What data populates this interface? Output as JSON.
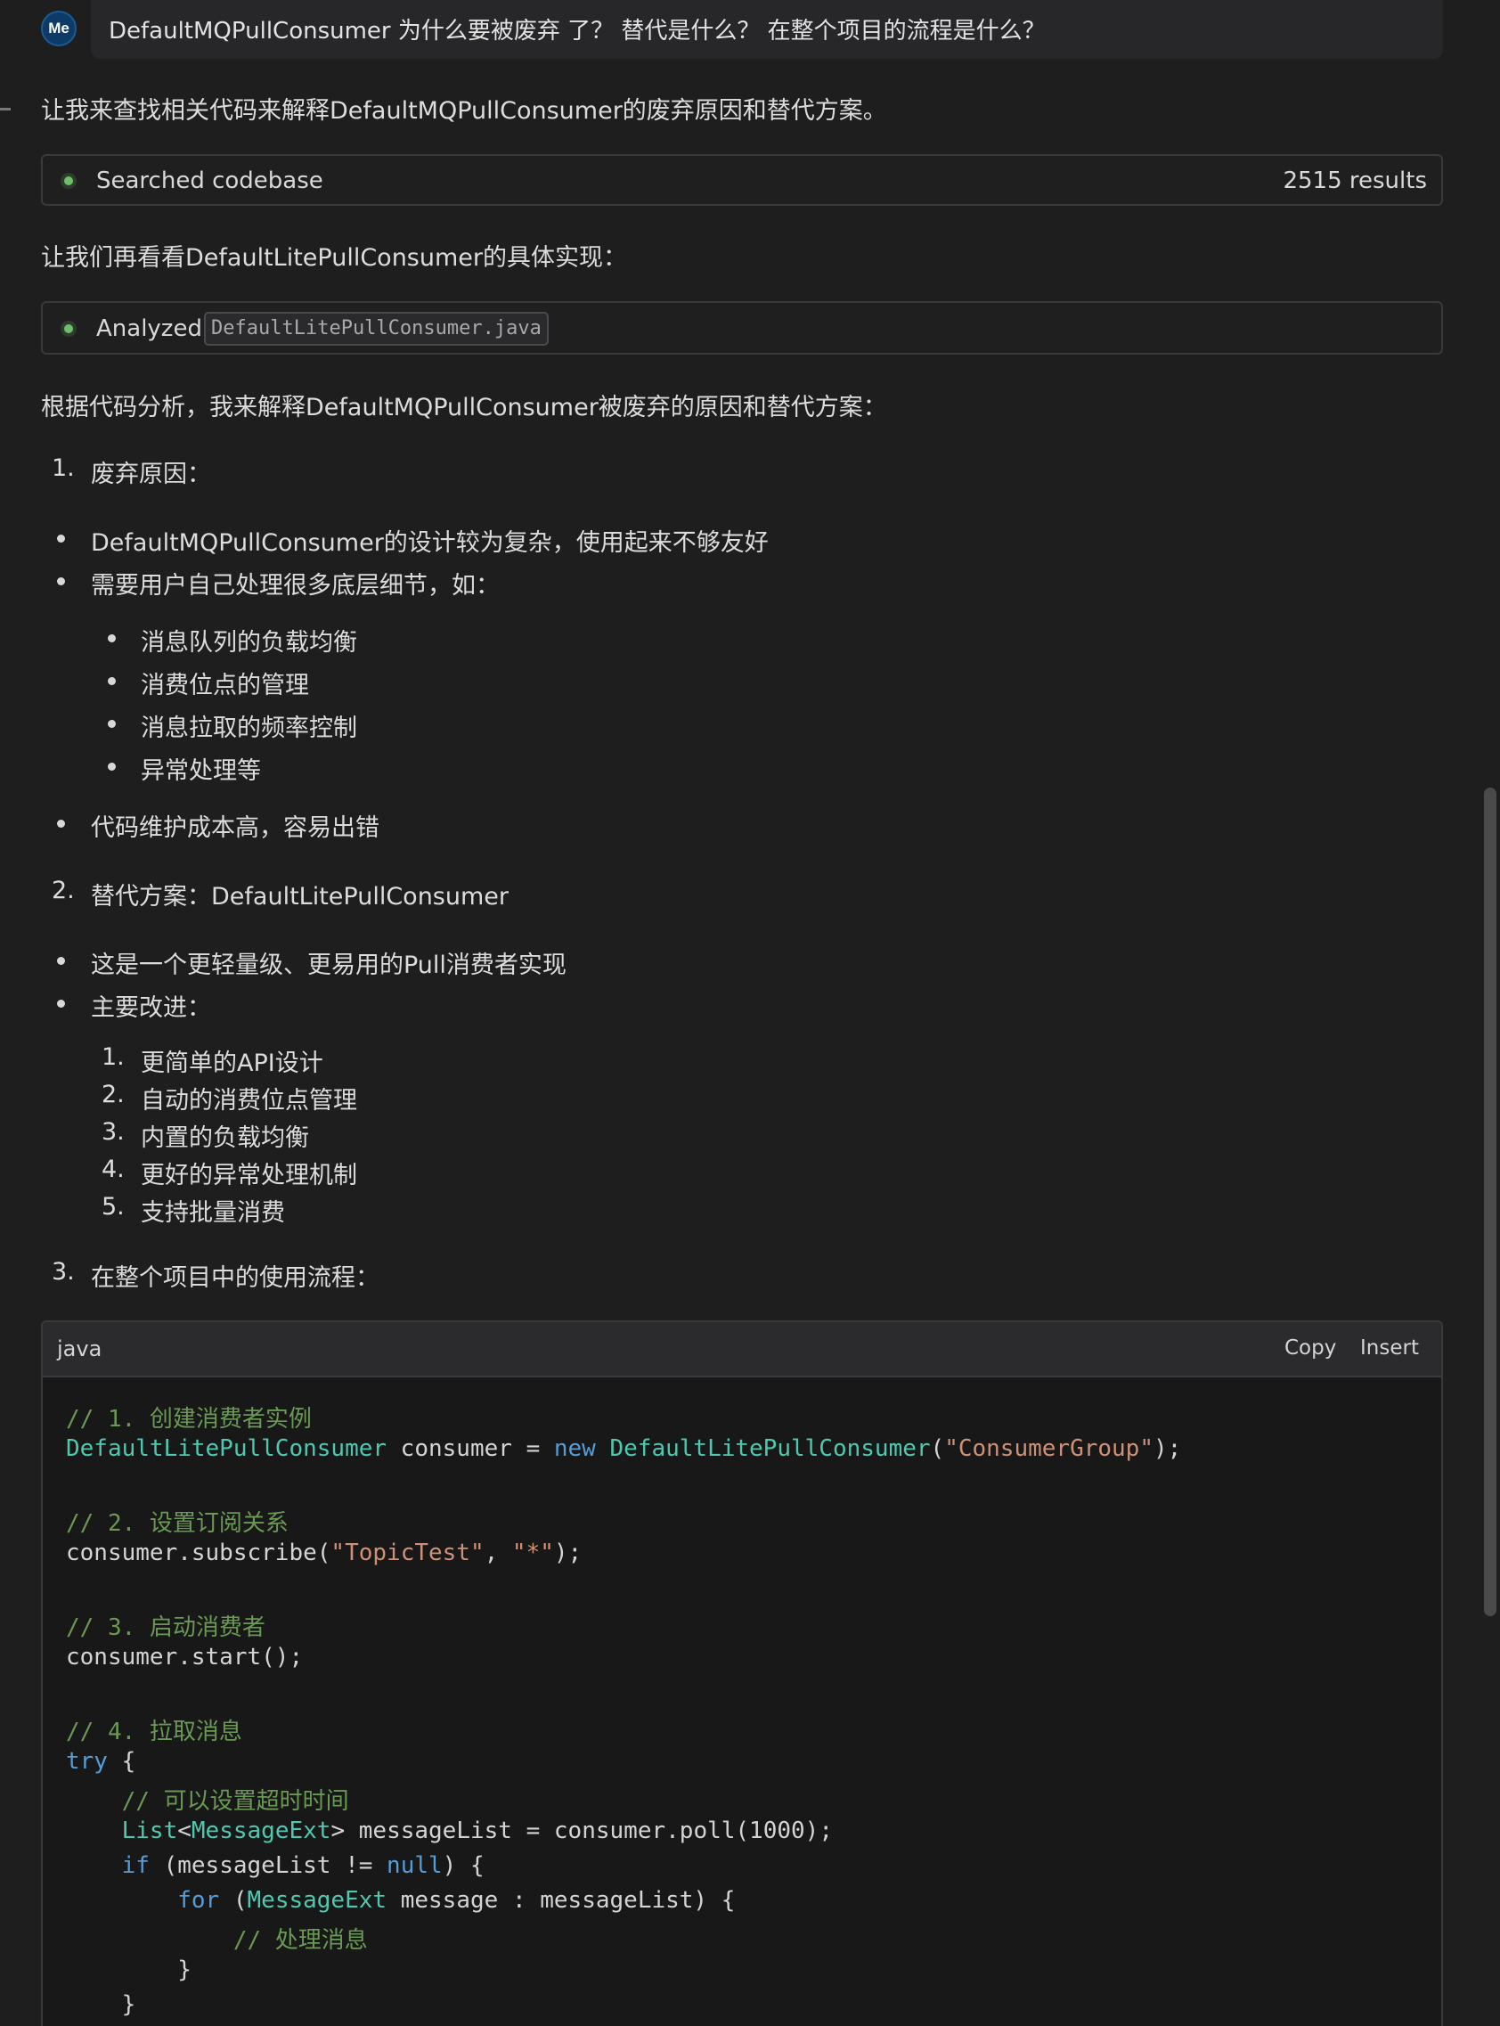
{
  "user_message": {
    "avatar": "Me",
    "text": "DefaultMQPullConsumer 为什么要被废弃 了？ 替代是什么？ 在整个项目的流程是什么？"
  },
  "intro": "让我来查找相关代码来解释DefaultMQPullConsumer的废弃原因和替代方案。",
  "search_tool": {
    "label": "Searched codebase",
    "count": "2515 results"
  },
  "look_more": "让我们再看看DefaultLitePullConsumer的具体实现：",
  "analyze_tool": {
    "label": "Analyzed",
    "file": "DefaultLitePullConsumer.java"
  },
  "analysis_intro": "根据代码分析，我来解释DefaultMQPullConsumer被废弃的原因和替代方案：",
  "section1": {
    "num": "1.",
    "title": "废弃原因：",
    "bullets": [
      "DefaultMQPullConsumer的设计较为复杂，使用起来不够友好",
      "需要用户自己处理很多底层细节，如："
    ],
    "sub_bullets": [
      "消息队列的负载均衡",
      "消费位点的管理",
      "消息拉取的频率控制",
      "异常处理等"
    ],
    "last_bullet": "代码维护成本高，容易出错"
  },
  "section2": {
    "num": "2.",
    "title": "替代方案：DefaultLitePullConsumer",
    "bullets": [
      "这是一个更轻量级、更易用的Pull消费者实现",
      "主要改进："
    ],
    "sub_items": [
      {
        "num": "1.",
        "text": "更简单的API设计"
      },
      {
        "num": "2.",
        "text": "自动的消费位点管理"
      },
      {
        "num": "3.",
        "text": "内置的负载均衡"
      },
      {
        "num": "4.",
        "text": "更好的异常处理机制"
      },
      {
        "num": "5.",
        "text": "支持批量消费"
      }
    ]
  },
  "section3": {
    "num": "3.",
    "title": "在整个项目中的使用流程："
  },
  "code": {
    "lang": "java",
    "copy_label": "Copy",
    "insert_label": "Insert",
    "lines": {
      "l1": "// 1. 创建消费者实例",
      "l2_type": "DefaultLitePullConsumer",
      "l2_mid": " consumer = ",
      "l2_new": "new",
      "l2_type2": "DefaultLitePullConsumer",
      "l2_open": "(",
      "l2_str": "\"ConsumerGroup\"",
      "l2_close": ");",
      "l4": "// 2. 设置订阅关系",
      "l5_a": "consumer.subscribe(",
      "l5_s1": "\"TopicTest\"",
      "l5_b": ", ",
      "l5_s2": "\"*\"",
      "l5_c": ");",
      "l7": "// 3. 启动消费者",
      "l8": "consumer.start();",
      "l10": "// 4. 拉取消息",
      "l11_kw": "try",
      "l11_rest": " {",
      "l12": "    // 可以设置超时时间",
      "l13_ind": "    ",
      "l13_t1": "List",
      "l13_lt": "<",
      "l13_t2": "MessageExt",
      "l13_rest": "> messageList = consumer.poll(1000);",
      "l14_ind": "    ",
      "l14_kw": "if",
      "l14_a": " (messageList != ",
      "l14_null": "null",
      "l14_b": ") {",
      "l15_ind": "        ",
      "l15_kw": "for",
      "l15_a": " (",
      "l15_t": "MessageExt",
      "l15_b": " message : messageList) {",
      "l16": "            // 处理消息",
      "l17": "        }",
      "l18": "    }"
    }
  }
}
